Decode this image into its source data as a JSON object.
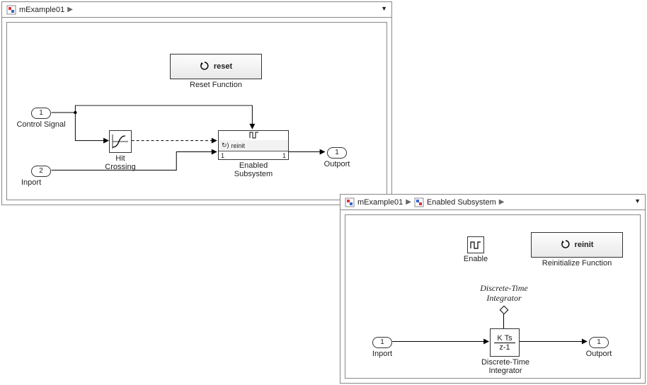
{
  "top_panel": {
    "breadcrumb": {
      "model": "mExample01"
    },
    "blocks": {
      "reset_block": {
        "text": "reset",
        "label": "Reset Function"
      },
      "control_port": {
        "num": "1",
        "label": "Control Signal"
      },
      "inport2": {
        "num": "2",
        "label": "Inport"
      },
      "hit_crossing": {
        "label_line1": "Hit",
        "label_line2": "Crossing"
      },
      "enabled_subsystem": {
        "reinit_text": "reinit",
        "in_port": "1",
        "out_port": "1",
        "label_line1": "Enabled",
        "label_line2": "Subsystem"
      },
      "outport": {
        "num": "1",
        "label": "Outport"
      }
    }
  },
  "bottom_panel": {
    "breadcrumb": {
      "model": "mExample01",
      "subsystem": "Enabled Subsystem"
    },
    "blocks": {
      "enable": {
        "label": "Enable"
      },
      "reinit_block": {
        "text": "reinit",
        "label": "Reinitialize Function"
      },
      "annotation": {
        "line1": "Discrete-Time",
        "line2": "Integrator"
      },
      "inport": {
        "num": "1",
        "label": "Inport"
      },
      "dti": {
        "top": "K Ts",
        "bot": "z-1",
        "label_line1": "Discrete-Time",
        "label_line2": "Integrator"
      },
      "outport": {
        "num": "1",
        "label": "Outport"
      }
    }
  },
  "diagram_data": {
    "top_model": {
      "name": "mExample01",
      "blocks": [
        {
          "type": "ResetFunction",
          "name": "Reset Function",
          "text": "reset"
        },
        {
          "type": "Inport",
          "name": "Control Signal",
          "port_number": 1
        },
        {
          "type": "Inport",
          "name": "Inport",
          "port_number": 2
        },
        {
          "type": "HitCrossing",
          "name": "Hit Crossing"
        },
        {
          "type": "EnabledSubsystem",
          "name": "Enabled Subsystem",
          "reinit_port_text": "reinit",
          "enable_port": true,
          "inports": [
            1
          ],
          "outports": [
            1
          ]
        },
        {
          "type": "Outport",
          "name": "Outport",
          "port_number": 1
        }
      ],
      "signals": [
        {
          "from": "Control Signal/1",
          "to": "Enabled Subsystem/Enable",
          "branch_to": "Hit Crossing/1"
        },
        {
          "from": "Hit Crossing/1",
          "to": "Enabled Subsystem/Reinit",
          "style": "dashed"
        },
        {
          "from": "Inport/1",
          "to": "Enabled Subsystem/1"
        },
        {
          "from": "Enabled Subsystem/1",
          "to": "Outport/1"
        }
      ]
    },
    "enabled_subsystem": {
      "path": "mExample01/Enabled Subsystem",
      "blocks": [
        {
          "type": "EnablePort",
          "name": "Enable"
        },
        {
          "type": "ReinitializeFunction",
          "name": "Reinitialize Function",
          "text": "reinit"
        },
        {
          "type": "Inport",
          "name": "Inport",
          "port_number": 1
        },
        {
          "type": "DiscreteTimeIntegrator",
          "name": "Discrete-Time Integrator",
          "display": "K Ts / (z-1)",
          "state_port_label": "Discrete-Time Integrator"
        },
        {
          "type": "Outport",
          "name": "Outport",
          "port_number": 1
        }
      ],
      "signals": [
        {
          "from": "Inport/1",
          "to": "Discrete-Time Integrator/1"
        },
        {
          "from": "Discrete-Time Integrator/1",
          "to": "Outport/1"
        }
      ]
    }
  }
}
